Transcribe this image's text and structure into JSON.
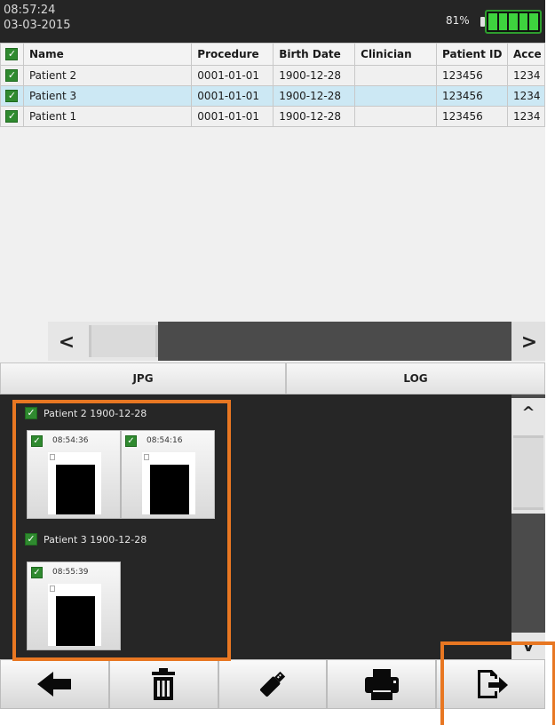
{
  "status_bar": {
    "time": "08:57:24",
    "date": "03-03-2015",
    "battery_percent": "81%"
  },
  "table": {
    "headers": [
      "Name",
      "Procedure",
      "Birth Date",
      "Clinician",
      "Patient ID",
      "Acce"
    ],
    "rows": [
      {
        "name": "Patient 2",
        "procedure": "0001-01-01",
        "birth_date": "1900-12-28",
        "clinician": "",
        "patient_id": "123456",
        "acce": "1234",
        "selected": false
      },
      {
        "name": "Patient 3",
        "procedure": "0001-01-01",
        "birth_date": "1900-12-28",
        "clinician": "",
        "patient_id": "123456",
        "acce": "1234",
        "selected": true
      },
      {
        "name": "Patient 1",
        "procedure": "0001-01-01",
        "birth_date": "1900-12-28",
        "clinician": "",
        "patient_id": "123456",
        "acce": "1234",
        "selected": false
      }
    ]
  },
  "scrollbar": {
    "left_arrow": "<",
    "right_arrow": ">"
  },
  "tabs": {
    "jpg": "JPG",
    "log": "LOG"
  },
  "gallery": {
    "groups": [
      {
        "label": "Patient 2  1900-12-28",
        "images": [
          {
            "time": "08:54:36"
          },
          {
            "time": "08:54:16"
          }
        ]
      },
      {
        "label": "Patient 3  1900-12-28",
        "images": [
          {
            "time": "08:55:39"
          }
        ]
      }
    ],
    "scroll_up": "^",
    "scroll_down": "v"
  },
  "toolbar": {
    "icons": [
      "back-arrow-icon",
      "trash-icon",
      "usb-drive-icon",
      "printer-icon",
      "export-icon"
    ]
  },
  "colors": {
    "highlight": "#e87722",
    "battery": "#3ed33e",
    "selected_row": "#cce8f4",
    "checkbox": "#2f8a2f"
  }
}
